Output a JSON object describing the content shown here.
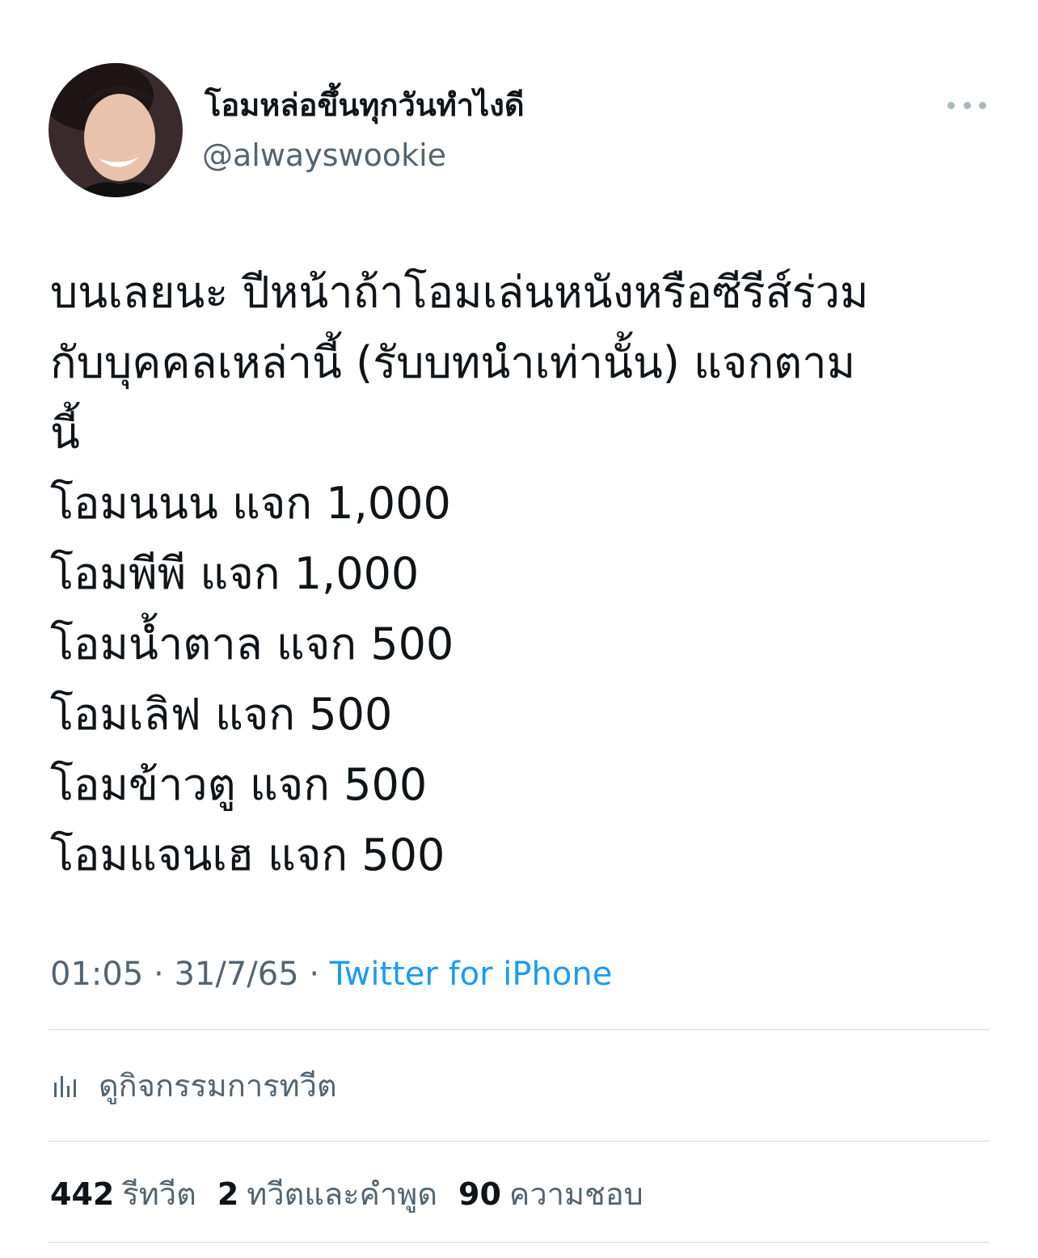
{
  "user": {
    "display_name": "โอมหล่อขึ้นทุกวันทำไงดี",
    "handle": "@alwayswookie"
  },
  "tweet": {
    "lines": [
      "บนเลยนะ ปีหน้าถ้าโอมเล่นหนังหรือซีรีส์ร่วม",
      "กับบุคคลเหล่านี้ (รับบทนำเท่านั้น) แจกตาม",
      "นี้",
      "โอมนนน แจก 1,000",
      "โอมพีพี แจก 1,000",
      "โอมน้ำตาล แจก 500",
      "โอมเลิฟ แจก 500",
      "โอมข้าวตู แจก 500",
      "โอมแจนเฮ แจก 500"
    ]
  },
  "meta": {
    "time": "01:05",
    "sep1": " · ",
    "date": "31/7/65",
    "sep2": " · ",
    "source": "Twitter for iPhone"
  },
  "activity": {
    "icon": "analytics-icon",
    "label": "ดูกิจกรรมการทวีต"
  },
  "stats": {
    "retweets_count": "442",
    "retweets_label": "รีทวีต",
    "quotes_count": "2",
    "quotes_label": "ทวีตและคำพูด",
    "likes_count": "90",
    "likes_label": "ความชอบ"
  },
  "colors": {
    "text": "#0f1419",
    "secondary": "#536471",
    "link": "#1d9bf0",
    "divider": "#cfd9de"
  }
}
